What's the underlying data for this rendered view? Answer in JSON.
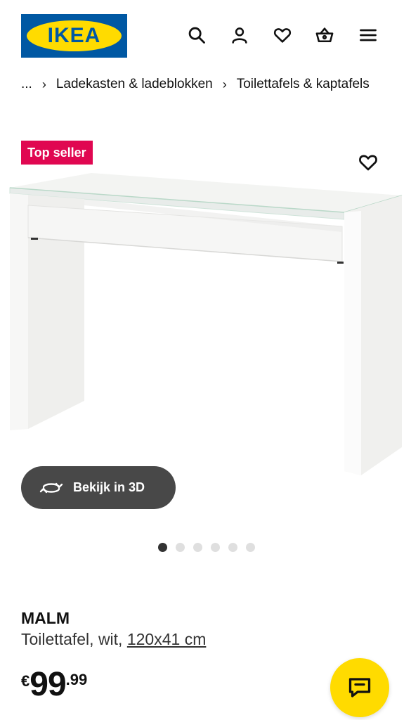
{
  "header": {
    "logo_text": "IKEA",
    "icons": [
      "search-icon",
      "user-icon",
      "heart-icon",
      "basket-icon",
      "menu-icon"
    ]
  },
  "breadcrumb": {
    "ellipsis": "...",
    "items": [
      "Ladekasten & ladeblokken",
      "Toilettafels & kaptafels"
    ]
  },
  "product": {
    "badge": "Top seller",
    "view_3d_label": "Bekijk in 3D",
    "gallery": {
      "count": 6,
      "active_index": 0
    },
    "name": "MALM",
    "description": "Toilettafel, wit, ",
    "size": "120x41 cm",
    "price": {
      "currency": "€",
      "integer": "99",
      "decimals": ".99"
    }
  },
  "colors": {
    "ikea_blue": "#0058a3",
    "ikea_yellow": "#ffdb00",
    "badge_red": "#e00751",
    "button_dark": "#484848"
  }
}
